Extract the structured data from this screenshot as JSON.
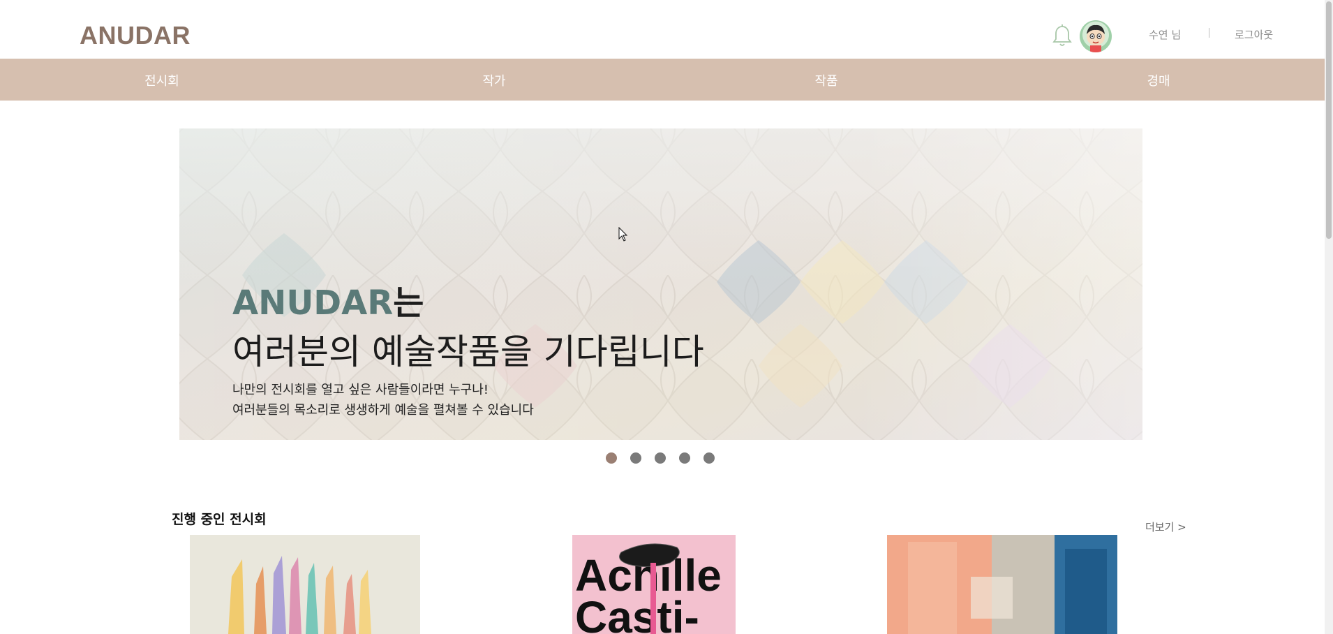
{
  "header": {
    "logo": "ANUDAR",
    "user_name": "수연 님",
    "separator": "|",
    "logout_label": "로그아웃"
  },
  "nav": {
    "items": [
      {
        "label": "전시회"
      },
      {
        "label": "작가"
      },
      {
        "label": "작품"
      },
      {
        "label": "경매"
      }
    ]
  },
  "banner": {
    "brand": "ANUDAR",
    "title_suffix": "는",
    "title_line2": "여러분의 예술작품을 기다립니다",
    "sub_line1": "나만의 전시회를 열고 싶은 사람들이라면 누구나!",
    "sub_line2": "여러분들의 목소리로 생생하게 예술을 펼쳐볼 수 있습니다",
    "slide_count": 5,
    "active_slide": 1
  },
  "section": {
    "title": "진행 중인 전시회",
    "more_label": "더보기 >"
  },
  "card2": {
    "poster_line1": "Achille",
    "poster_line2": "Casti-"
  },
  "colors": {
    "brand": "#8a7366",
    "nav_bg": "#d6bfaf",
    "banner_brand": "#5a7a78",
    "dot_active": "#9a7f73",
    "dot": "#7a7a7a"
  }
}
